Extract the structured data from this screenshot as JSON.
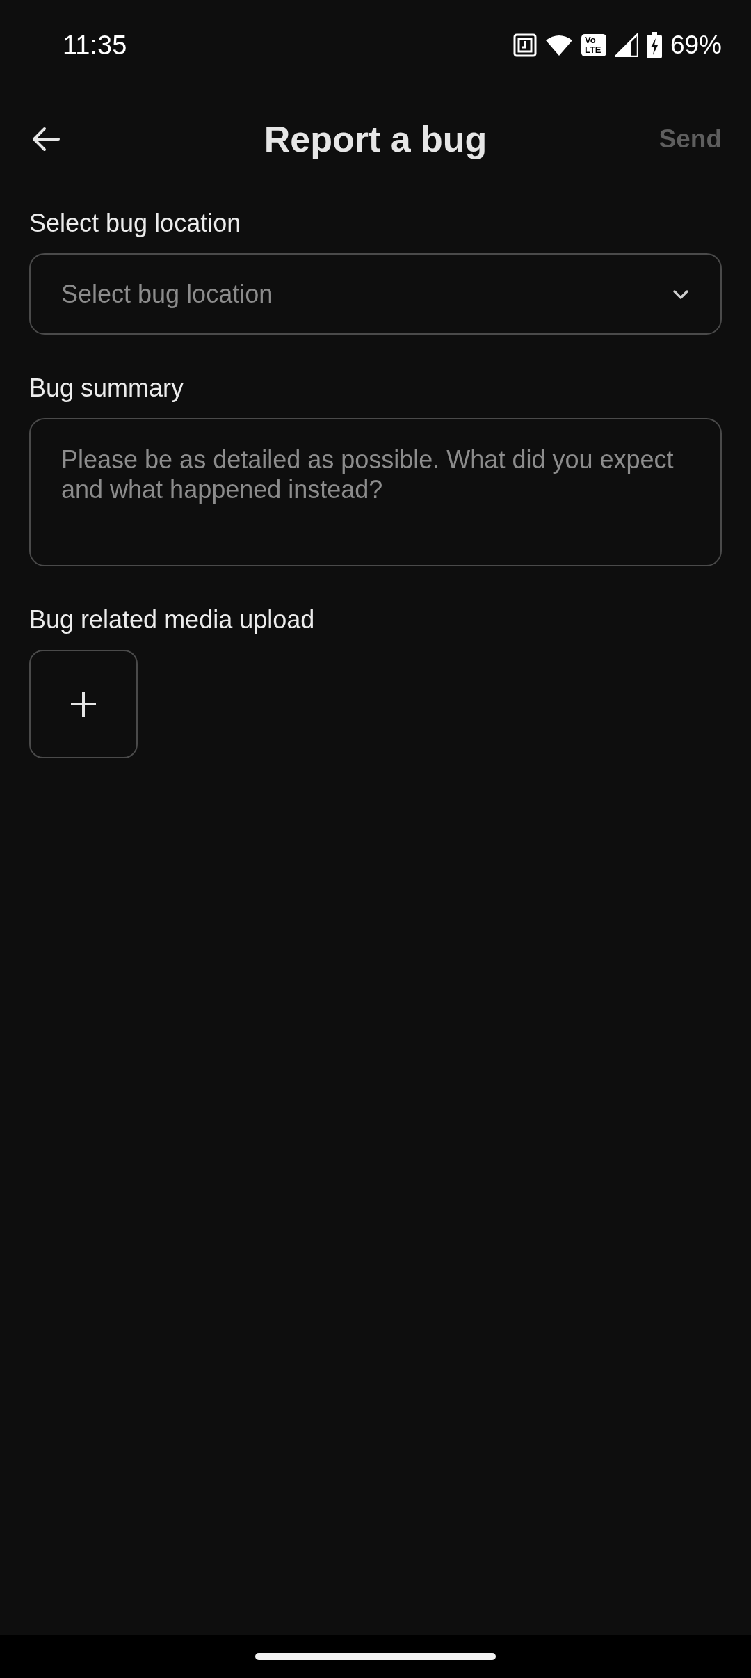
{
  "status_bar": {
    "time": "11:35",
    "volte": [
      "Vo",
      "LTE"
    ],
    "battery": "69%"
  },
  "header": {
    "title": "Report a bug",
    "send": {
      "label": "Send",
      "disabled": true
    }
  },
  "form": [
    {
      "kind": "dropdown",
      "label": "Select bug location",
      "placeholder": "Select bug location"
    },
    {
      "kind": "textarea",
      "label": "Bug summary",
      "placeholder": "Please be as detailed as possible. What did you expect and what happened instead?"
    },
    {
      "kind": "upload",
      "label": "Bug related media upload"
    }
  ]
}
